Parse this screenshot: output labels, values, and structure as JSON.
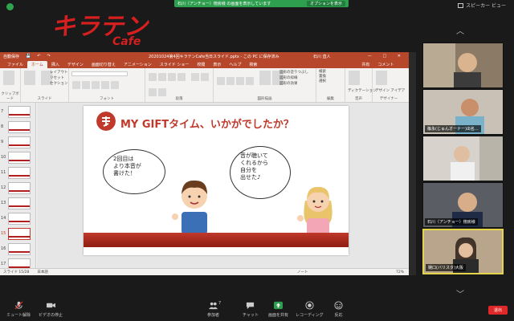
{
  "share_banner": {
    "text": "石川（アンチョー）徳房様 の画面を表示しています",
    "options_label": "オプションを表示"
  },
  "view_toggle": {
    "label": "スピーカー ビュー"
  },
  "logo": {
    "main": "キラテン",
    "sub": "Cafe"
  },
  "ppt": {
    "quick_label": "自動保存",
    "doc_title": "20201024第4回キラテンCafe当日スライド.pptx - この PC に保存済み",
    "user": "石川 直人",
    "window_controls": "— □ ✕",
    "tabs": [
      "ファイル",
      "ホーム",
      "挿入",
      "デザイン",
      "画面切り替え",
      "アニメーション",
      "スライド ショー",
      "校閲",
      "表示",
      "ヘルプ",
      "検索"
    ],
    "active_tab": 1,
    "share_label": "共有",
    "comment_label": "コメント",
    "ribbon_groups": [
      {
        "label": "クリップボード",
        "items": [
          "貼り付け"
        ]
      },
      {
        "label": "スライド",
        "items": [
          "新しいスライド",
          "スライドの再利用",
          "レイアウト",
          "リセット",
          "セクション"
        ]
      },
      {
        "label": "フォント",
        "items": []
      },
      {
        "label": "段落",
        "items": []
      },
      {
        "label": "図形描画",
        "items": [
          "配置",
          "クイックスタイル"
        ]
      },
      {
        "label": "編集",
        "items": [
          "検索",
          "置換",
          "選択"
        ]
      },
      {
        "label": "音声",
        "items": [
          "ディクテーション"
        ]
      },
      {
        "label": "デザイナー",
        "items": [
          "デザイン アイデア"
        ]
      }
    ],
    "ribbon_labels": {
      "shape_fill": "図形の塗りつぶし",
      "shape_outline": "図形の枠線",
      "shape_effect": "図形の効果"
    },
    "thumb_numbers": [
      "7",
      "8",
      "9",
      "10",
      "11",
      "12",
      "13",
      "14",
      "15",
      "16",
      "17"
    ],
    "selected_thumb": "15",
    "slide": {
      "title": "MY GIFTタイム、いかがでしたか？",
      "bubble_left": [
        "2回目は",
        "より本音が",
        "書けた！"
      ],
      "bubble_right": [
        "音が聴いて",
        "くれるから",
        "自分を",
        "出せた♪"
      ]
    },
    "status": {
      "slide_pos": "スライド 15/28",
      "language": "日本語",
      "notes": "ノート",
      "zoom": "72%"
    }
  },
  "participants": [
    {
      "name": ""
    },
    {
      "name": "篠永(じゅんオーナー)出名..."
    },
    {
      "name": ""
    },
    {
      "name": "石川（アンチョー）徳房様"
    },
    {
      "name": "樋口(バリスタ)大阪"
    }
  ],
  "toolbar": {
    "mute": "ミュート解除",
    "video": "ビデオの停止",
    "participants": "参加者",
    "participants_count": "7",
    "chat": "チャット",
    "share": "画面を共有",
    "record": "レコーディング",
    "reactions": "反応",
    "end": "退出"
  },
  "colors": {
    "accent": "#c0392b",
    "zoom_green": "#2e9e4f",
    "end_red": "#e02828",
    "active_border": "#e3d44a"
  }
}
